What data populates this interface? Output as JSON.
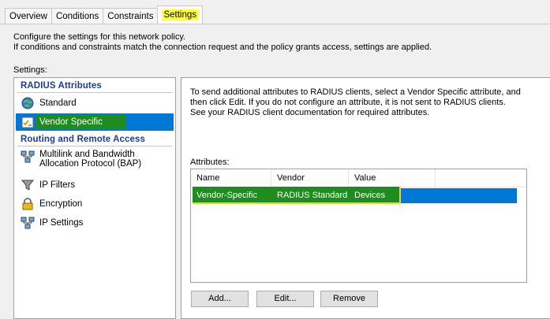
{
  "tabs": [
    {
      "label": "Overview"
    },
    {
      "label": "Conditions"
    },
    {
      "label": "Constraints"
    },
    {
      "label": "Settings"
    }
  ],
  "intro": {
    "line1": "Configure the settings for this network policy.",
    "line2": "If conditions and constraints match the connection request and the policy grants access, settings are applied."
  },
  "settings_label": "Settings:",
  "nav": {
    "radius_header": "RADIUS Attributes",
    "radius_items": [
      {
        "label": "Standard",
        "icon": "globe-icon"
      },
      {
        "label": "Vendor Specific",
        "icon": "checklist-icon"
      }
    ],
    "rra_header": "Routing and Remote Access",
    "rra_items": [
      {
        "label_line1": "Multilink and Bandwidth",
        "label_line2": "Allocation Protocol (BAP)",
        "icon": "network-icon"
      },
      {
        "label": "IP Filters",
        "icon": "filter-icon"
      },
      {
        "label": "Encryption",
        "icon": "lock-icon"
      },
      {
        "label": "IP Settings",
        "icon": "network-icon"
      }
    ]
  },
  "content": {
    "description": "To send additional attributes to RADIUS clients, select a Vendor Specific attribute, and then click Edit. If you do not configure an attribute, it is not sent to RADIUS clients. See your RADIUS client documentation for required attributes.",
    "attributes_label": "Attributes:",
    "columns": {
      "name": "Name",
      "vendor": "Vendor",
      "value": "Value"
    },
    "rows": [
      {
        "name": "Vendor-Specific",
        "vendor": "RADIUS Standard",
        "value": "Devices"
      }
    ],
    "buttons": {
      "add": "Add...",
      "edit": "Edit...",
      "remove": "Remove"
    }
  },
  "colors": {
    "selection": "#0078d7",
    "highlight_green": "#1e8c1e",
    "highlight_yellow": "#ffff33",
    "header_blue": "#1e3c96"
  }
}
